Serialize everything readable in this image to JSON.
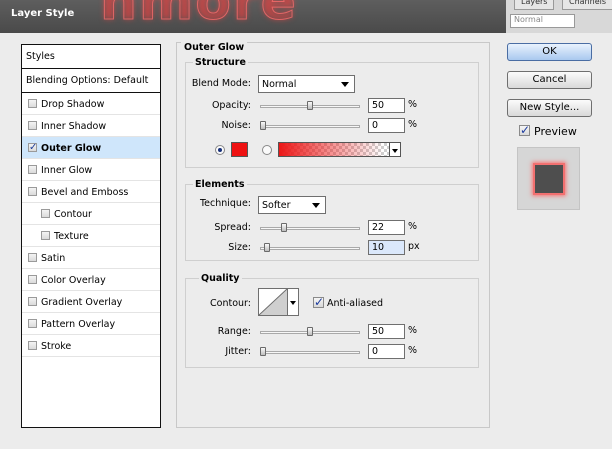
{
  "window": {
    "title": "Layer Style"
  },
  "background_app": {
    "text": "nmore",
    "panel_tabs": [
      "Layers",
      "Channels"
    ],
    "blend_value": "Normal"
  },
  "left_panel": {
    "styles_label": "Styles",
    "blending_label": "Blending Options: Default",
    "effects": [
      {
        "label": "Drop Shadow",
        "checked": false
      },
      {
        "label": "Inner Shadow",
        "checked": false
      },
      {
        "label": "Outer Glow",
        "checked": true,
        "selected": true
      },
      {
        "label": "Inner Glow",
        "checked": false
      },
      {
        "label": "Bevel and Emboss",
        "checked": false
      },
      {
        "label": "Contour",
        "checked": false,
        "sub": true
      },
      {
        "label": "Texture",
        "checked": false,
        "sub": true
      },
      {
        "label": "Satin",
        "checked": false
      },
      {
        "label": "Color Overlay",
        "checked": false
      },
      {
        "label": "Gradient Overlay",
        "checked": false
      },
      {
        "label": "Pattern Overlay",
        "checked": false
      },
      {
        "label": "Stroke",
        "checked": false
      }
    ]
  },
  "outer_glow": {
    "title": "Outer Glow",
    "structure": {
      "heading": "Structure",
      "blend_mode_label": "Blend Mode:",
      "blend_mode_value": "Normal",
      "opacity_label": "Opacity:",
      "opacity_value": "50",
      "opacity_level": 0.5,
      "noise_label": "Noise:",
      "noise_value": "0",
      "noise_level": 0,
      "percent": "%",
      "glow_color": "#ee1111",
      "color_mode": "solid"
    },
    "elements": {
      "heading": "Elements",
      "technique_label": "Technique:",
      "technique_value": "Softer",
      "spread_label": "Spread:",
      "spread_value": "22",
      "spread_level": 0.22,
      "size_label": "Size:",
      "size_value": "10",
      "size_level": 0.04,
      "percent": "%",
      "px": "px"
    },
    "quality": {
      "heading": "Quality",
      "contour_label": "Contour:",
      "anti_aliased_label": "Anti-aliased",
      "anti_aliased_checked": true,
      "range_label": "Range:",
      "range_value": "50",
      "range_level": 0.5,
      "jitter_label": "Jitter:",
      "jitter_value": "0",
      "jitter_level": 0,
      "percent": "%"
    }
  },
  "buttons": {
    "ok": "OK",
    "cancel": "Cancel",
    "new_style": "New Style...",
    "preview_label": "Preview",
    "preview_checked": true
  },
  "colors": {
    "selected_row": "#cfe6fb",
    "glow": "#ee1111",
    "preview_fill": "#4e4e4e",
    "primary_button": "#a9c8ef"
  }
}
